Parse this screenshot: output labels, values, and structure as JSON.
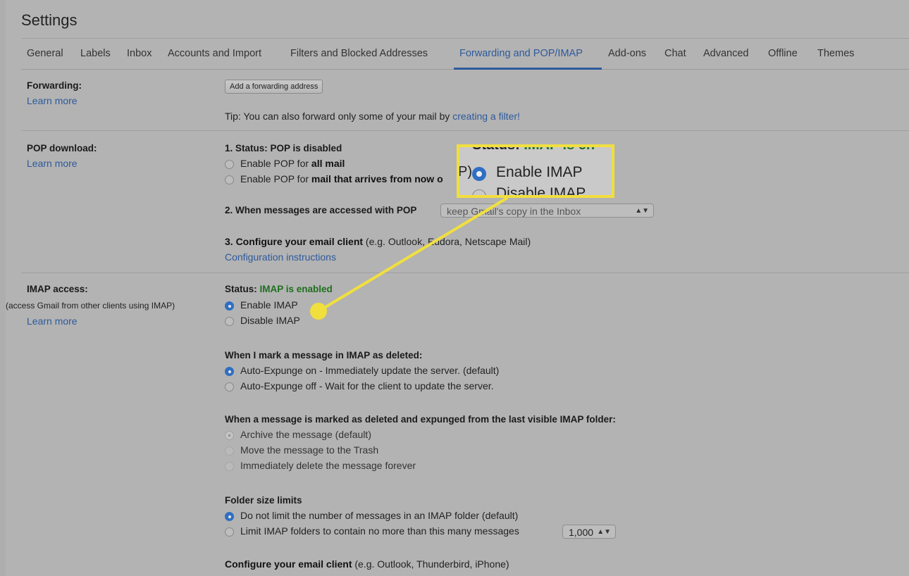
{
  "title": "Settings",
  "tabs": [
    {
      "label": "General"
    },
    {
      "label": "Labels"
    },
    {
      "label": "Inbox"
    },
    {
      "label": "Accounts and Import"
    },
    {
      "label": "Filters and Blocked Addresses"
    },
    {
      "label": "Forwarding and POP/IMAP"
    },
    {
      "label": "Add-ons"
    },
    {
      "label": "Chat"
    },
    {
      "label": "Advanced"
    },
    {
      "label": "Offline"
    },
    {
      "label": "Themes"
    }
  ],
  "active_tab": "Forwarding and POP/IMAP",
  "forwarding": {
    "heading": "Forwarding:",
    "learn_more": "Learn more",
    "add_button": "Add a forwarding address",
    "tip_prefix": "Tip: You can also forward only some of your mail by ",
    "tip_link": "creating a filter!"
  },
  "pop": {
    "heading": "POP download:",
    "learn_more": "Learn more",
    "status_label": "1. Status: POP is disabled",
    "opt1_prefix": "Enable POP for ",
    "opt1_bold": "all mail",
    "opt2_prefix": "Enable POP for ",
    "opt2_bold": "mail that arrives from now o",
    "access_label": "2. When messages are accessed with POP",
    "access_select": "keep Gmail's copy in the Inbox",
    "configure_bold": "3. Configure your email client",
    "configure_rest": " (e.g. Outlook, Eudora, Netscape Mail)",
    "configure_link": "Configuration instructions"
  },
  "imap": {
    "heading": "IMAP access:",
    "subheading": "(access Gmail from other clients using IMAP)",
    "learn_more": "Learn more",
    "status_prefix": "Status: ",
    "status_value": "IMAP is enabled",
    "enable": "Enable IMAP",
    "disable": "Disable IMAP",
    "deleted_heading": "When I mark a message in IMAP as deleted:",
    "expunge_on": "Auto-Expunge on - Immediately update the server. (default)",
    "expunge_off": "Auto-Expunge off - Wait for the client to update the server.",
    "expunged_heading": "When a message is marked as deleted and expunged from the last visible IMAP folder:",
    "archive": "Archive the message (default)",
    "trash": "Move the message to the Trash",
    "delete_forever": "Immediately delete the message forever",
    "folder_heading": "Folder size limits",
    "no_limit": "Do not limit the number of messages in an IMAP folder (default)",
    "limit": "Limit IMAP folders to contain no more than this many messages",
    "limit_value": "1,000",
    "client_bold": "Configure your email client",
    "client_rest": " (e.g. Outlook, Thunderbird, iPhone)"
  },
  "callout": {
    "top_text": "Status: ",
    "top_text_green": "IMAP is en",
    "paren": "P)",
    "enable": "Enable IMAP",
    "disable": "Disable IMAP"
  },
  "colors": {
    "link": "#2d5a9c",
    "status_green": "#1f6f1f",
    "highlight_yellow": "#f1df3e",
    "radio_blue": "#2f6fc3"
  }
}
